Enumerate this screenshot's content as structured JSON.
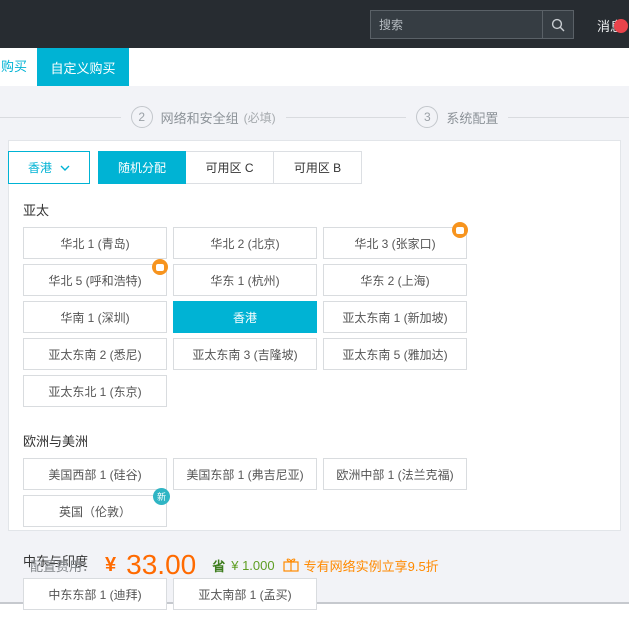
{
  "topbar": {
    "search_placeholder": "搜索",
    "messages_label": "消息"
  },
  "tabs": {
    "quick_buy_label": "购买",
    "custom_buy_label": "自定义购买"
  },
  "steps": [
    {
      "number": "2",
      "label": "网络和安全组",
      "note": "(必填)"
    },
    {
      "number": "3",
      "label": "系统配置",
      "note": ""
    }
  ],
  "region_selector": {
    "dropdown_value": "香港",
    "zone_tabs": [
      {
        "label": "随机分配",
        "active": true
      },
      {
        "label": "可用区 C",
        "active": false
      },
      {
        "label": "可用区 B",
        "active": false
      }
    ]
  },
  "region_groups": [
    {
      "title": "亚太",
      "regions": [
        {
          "label": "华北 1 (青岛)"
        },
        {
          "label": "华北 2 (北京)"
        },
        {
          "label": "华北 3 (张家口)",
          "badge": "discount"
        },
        {
          "label": "华北 5 (呼和浩特)",
          "badge": "discount"
        },
        {
          "label": "华东 1 (杭州)"
        },
        {
          "label": "华东 2 (上海)"
        },
        {
          "label": "华南 1 (深圳)"
        },
        {
          "label": "香港",
          "selected": true
        },
        {
          "label": "亚太东南 1 (新加坡)"
        },
        {
          "label": "亚太东南 2 (悉尼)"
        },
        {
          "label": "亚太东南 3 (吉隆坡)"
        },
        {
          "label": "亚太东南 5 (雅加达)"
        },
        {
          "label": "亚太东北 1 (东京)"
        }
      ]
    },
    {
      "title": "欧洲与美洲",
      "regions": [
        {
          "label": "美国西部 1 (硅谷)"
        },
        {
          "label": "美国东部 1 (弗吉尼亚)"
        },
        {
          "label": "欧洲中部 1 (法兰克福)"
        },
        {
          "label": "英国（伦敦）",
          "badge": "new",
          "badge_text": "新"
        }
      ]
    },
    {
      "title": "中东与印度",
      "regions": [
        {
          "label": "中东东部 1 (迪拜)"
        },
        {
          "label": "亚太南部 1 (孟买)"
        }
      ]
    }
  ],
  "footer": {
    "fee_label": "配置费用：",
    "currency": "¥",
    "amount": "33.00",
    "save_label": "省",
    "save_amount": "¥ 1.000",
    "promo_text": "专有网络实例立享9.5折"
  },
  "colors": {
    "accent_cyan": "#00b3d4",
    "badge_orange": "#f7941e",
    "badge_teal": "#2fb5c4",
    "price_orange": "#ff6a00",
    "save_green": "#5e9e23",
    "notification_red": "#e9434b",
    "topbar_dark": "#272c31",
    "page_gray": "#f2f3f7"
  }
}
